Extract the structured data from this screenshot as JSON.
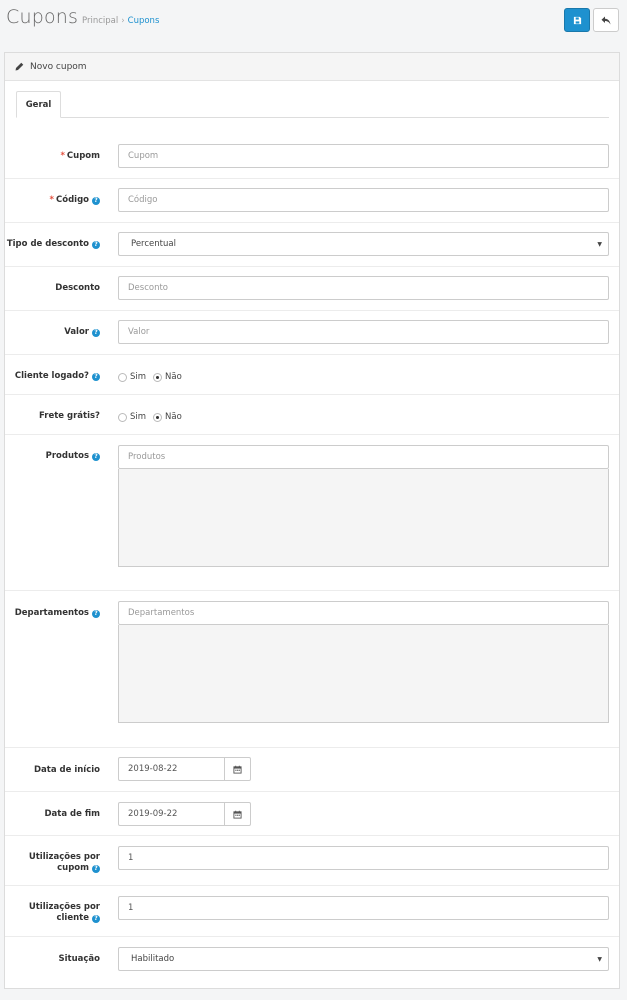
{
  "header": {
    "title": "Cupons",
    "breadcrumb": {
      "home": "Principal",
      "separator": "›",
      "current": "Cupons"
    },
    "save_icon": "save-icon",
    "back_icon": "reply-icon"
  },
  "panel": {
    "title": "Novo cupom",
    "title_icon": "pencil-icon",
    "tabs": [
      {
        "label": "Geral"
      }
    ]
  },
  "form": {
    "cupom": {
      "label": "Cupom",
      "required": "*",
      "placeholder": "Cupom"
    },
    "codigo": {
      "label": "Código",
      "required": "*",
      "placeholder": "Código",
      "help": "?"
    },
    "tipo_desconto": {
      "label": "Tipo de desconto",
      "help": "?",
      "value": "Percentual",
      "caret": "▼"
    },
    "desconto": {
      "label": "Desconto",
      "placeholder": "Desconto"
    },
    "valor": {
      "label": "Valor",
      "help": "?",
      "placeholder": "Valor"
    },
    "cliente_logado": {
      "label": "Cliente logado?",
      "help": "?",
      "options": [
        "Sim",
        "Não"
      ],
      "selected": "Não"
    },
    "frete_gratis": {
      "label": "Frete grátis?",
      "options": [
        "Sim",
        "Não"
      ],
      "selected": "Não"
    },
    "produtos": {
      "label": "Produtos",
      "help": "?",
      "placeholder": "Produtos"
    },
    "departamentos": {
      "label": "Departamentos",
      "help": "?",
      "placeholder": "Departamentos"
    },
    "data_inicio": {
      "label": "Data de início",
      "value": "2019-08-22",
      "icon": "calendar-icon"
    },
    "data_fim": {
      "label": "Data de fim",
      "value": "2019-09-22",
      "icon": "calendar-icon"
    },
    "utilizacoes_cupom": {
      "label_line1": "Utilizações por",
      "label_line2": "cupom",
      "help": "?",
      "value": "1"
    },
    "utilizacoes_cliente": {
      "label_line1": "Utilizações por",
      "label_line2": "cliente",
      "help": "?",
      "value": "1"
    },
    "situacao": {
      "label": "Situação",
      "value": "Habilitado",
      "caret": "▼"
    }
  },
  "colors": {
    "primary": "#1e91cf",
    "required": "#e3503e",
    "well": "#f5f5f5"
  }
}
